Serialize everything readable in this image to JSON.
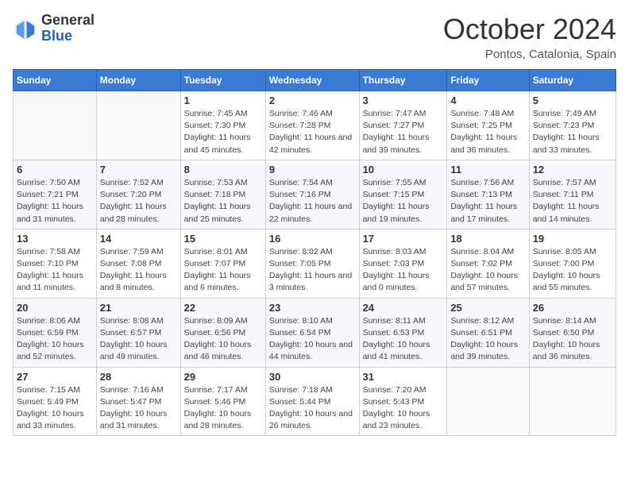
{
  "header": {
    "logo": {
      "line1": "General",
      "line2": "Blue"
    },
    "title": "October 2024",
    "subtitle": "Pontos, Catalonia, Spain"
  },
  "weekdays": [
    "Sunday",
    "Monday",
    "Tuesday",
    "Wednesday",
    "Thursday",
    "Friday",
    "Saturday"
  ],
  "weeks": [
    [
      {
        "day": "",
        "sunrise": "",
        "sunset": "",
        "daylight": ""
      },
      {
        "day": "",
        "sunrise": "",
        "sunset": "",
        "daylight": ""
      },
      {
        "day": "1",
        "sunrise": "Sunrise: 7:45 AM",
        "sunset": "Sunset: 7:30 PM",
        "daylight": "Daylight: 11 hours and 45 minutes."
      },
      {
        "day": "2",
        "sunrise": "Sunrise: 7:46 AM",
        "sunset": "Sunset: 7:28 PM",
        "daylight": "Daylight: 11 hours and 42 minutes."
      },
      {
        "day": "3",
        "sunrise": "Sunrise: 7:47 AM",
        "sunset": "Sunset: 7:27 PM",
        "daylight": "Daylight: 11 hours and 39 minutes."
      },
      {
        "day": "4",
        "sunrise": "Sunrise: 7:48 AM",
        "sunset": "Sunset: 7:25 PM",
        "daylight": "Daylight: 11 hours and 36 minutes."
      },
      {
        "day": "5",
        "sunrise": "Sunrise: 7:49 AM",
        "sunset": "Sunset: 7:23 PM",
        "daylight": "Daylight: 11 hours and 33 minutes."
      }
    ],
    [
      {
        "day": "6",
        "sunrise": "Sunrise: 7:50 AM",
        "sunset": "Sunset: 7:21 PM",
        "daylight": "Daylight: 11 hours and 31 minutes."
      },
      {
        "day": "7",
        "sunrise": "Sunrise: 7:52 AM",
        "sunset": "Sunset: 7:20 PM",
        "daylight": "Daylight: 11 hours and 28 minutes."
      },
      {
        "day": "8",
        "sunrise": "Sunrise: 7:53 AM",
        "sunset": "Sunset: 7:18 PM",
        "daylight": "Daylight: 11 hours and 25 minutes."
      },
      {
        "day": "9",
        "sunrise": "Sunrise: 7:54 AM",
        "sunset": "Sunset: 7:16 PM",
        "daylight": "Daylight: 11 hours and 22 minutes."
      },
      {
        "day": "10",
        "sunrise": "Sunrise: 7:55 AM",
        "sunset": "Sunset: 7:15 PM",
        "daylight": "Daylight: 11 hours and 19 minutes."
      },
      {
        "day": "11",
        "sunrise": "Sunrise: 7:56 AM",
        "sunset": "Sunset: 7:13 PM",
        "daylight": "Daylight: 11 hours and 17 minutes."
      },
      {
        "day": "12",
        "sunrise": "Sunrise: 7:57 AM",
        "sunset": "Sunset: 7:11 PM",
        "daylight": "Daylight: 11 hours and 14 minutes."
      }
    ],
    [
      {
        "day": "13",
        "sunrise": "Sunrise: 7:58 AM",
        "sunset": "Sunset: 7:10 PM",
        "daylight": "Daylight: 11 hours and 11 minutes."
      },
      {
        "day": "14",
        "sunrise": "Sunrise: 7:59 AM",
        "sunset": "Sunset: 7:08 PM",
        "daylight": "Daylight: 11 hours and 8 minutes."
      },
      {
        "day": "15",
        "sunrise": "Sunrise: 8:01 AM",
        "sunset": "Sunset: 7:07 PM",
        "daylight": "Daylight: 11 hours and 6 minutes."
      },
      {
        "day": "16",
        "sunrise": "Sunrise: 8:02 AM",
        "sunset": "Sunset: 7:05 PM",
        "daylight": "Daylight: 11 hours and 3 minutes."
      },
      {
        "day": "17",
        "sunrise": "Sunrise: 8:03 AM",
        "sunset": "Sunset: 7:03 PM",
        "daylight": "Daylight: 11 hours and 0 minutes."
      },
      {
        "day": "18",
        "sunrise": "Sunrise: 8:04 AM",
        "sunset": "Sunset: 7:02 PM",
        "daylight": "Daylight: 10 hours and 57 minutes."
      },
      {
        "day": "19",
        "sunrise": "Sunrise: 8:05 AM",
        "sunset": "Sunset: 7:00 PM",
        "daylight": "Daylight: 10 hours and 55 minutes."
      }
    ],
    [
      {
        "day": "20",
        "sunrise": "Sunrise: 8:06 AM",
        "sunset": "Sunset: 6:59 PM",
        "daylight": "Daylight: 10 hours and 52 minutes."
      },
      {
        "day": "21",
        "sunrise": "Sunrise: 8:08 AM",
        "sunset": "Sunset: 6:57 PM",
        "daylight": "Daylight: 10 hours and 49 minutes."
      },
      {
        "day": "22",
        "sunrise": "Sunrise: 8:09 AM",
        "sunset": "Sunset: 6:56 PM",
        "daylight": "Daylight: 10 hours and 46 minutes."
      },
      {
        "day": "23",
        "sunrise": "Sunrise: 8:10 AM",
        "sunset": "Sunset: 6:54 PM",
        "daylight": "Daylight: 10 hours and 44 minutes."
      },
      {
        "day": "24",
        "sunrise": "Sunrise: 8:11 AM",
        "sunset": "Sunset: 6:53 PM",
        "daylight": "Daylight: 10 hours and 41 minutes."
      },
      {
        "day": "25",
        "sunrise": "Sunrise: 8:12 AM",
        "sunset": "Sunset: 6:51 PM",
        "daylight": "Daylight: 10 hours and 39 minutes."
      },
      {
        "day": "26",
        "sunrise": "Sunrise: 8:14 AM",
        "sunset": "Sunset: 6:50 PM",
        "daylight": "Daylight: 10 hours and 36 minutes."
      }
    ],
    [
      {
        "day": "27",
        "sunrise": "Sunrise: 7:15 AM",
        "sunset": "Sunset: 5:49 PM",
        "daylight": "Daylight: 10 hours and 33 minutes."
      },
      {
        "day": "28",
        "sunrise": "Sunrise: 7:16 AM",
        "sunset": "Sunset: 5:47 PM",
        "daylight": "Daylight: 10 hours and 31 minutes."
      },
      {
        "day": "29",
        "sunrise": "Sunrise: 7:17 AM",
        "sunset": "Sunset: 5:46 PM",
        "daylight": "Daylight: 10 hours and 28 minutes."
      },
      {
        "day": "30",
        "sunrise": "Sunrise: 7:18 AM",
        "sunset": "Sunset: 5:44 PM",
        "daylight": "Daylight: 10 hours and 26 minutes."
      },
      {
        "day": "31",
        "sunrise": "Sunrise: 7:20 AM",
        "sunset": "Sunset: 5:43 PM",
        "daylight": "Daylight: 10 hours and 23 minutes."
      },
      {
        "day": "",
        "sunrise": "",
        "sunset": "",
        "daylight": ""
      },
      {
        "day": "",
        "sunrise": "",
        "sunset": "",
        "daylight": ""
      }
    ]
  ]
}
